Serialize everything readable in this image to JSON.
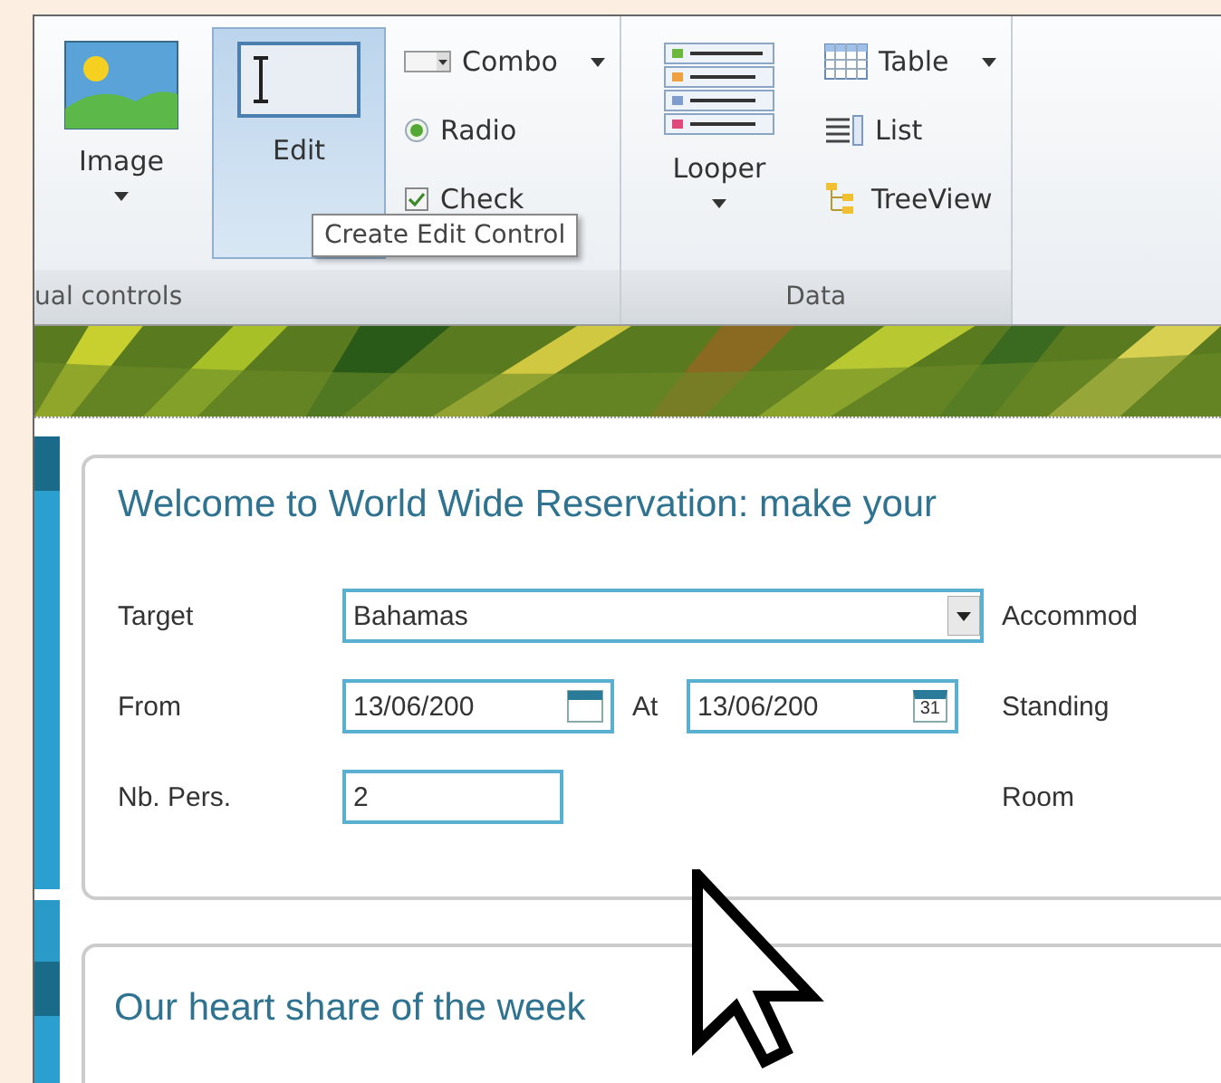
{
  "ribbon": {
    "groups": [
      {
        "label": "ual controls",
        "large_buttons": [
          {
            "label": "Image",
            "selected": false,
            "dropdown": true
          },
          {
            "label": "Edit",
            "kind": "edit",
            "selected": true,
            "dropdown": false
          }
        ],
        "small_buttons": [
          {
            "label": "Combo",
            "kind": "combo",
            "dropdown": true
          },
          {
            "label": "Radio",
            "kind": "radio",
            "dropdown": false,
            "checked": true
          },
          {
            "label": "Check",
            "kind": "check",
            "dropdown": false,
            "checked": true
          }
        ]
      },
      {
        "label": "Data",
        "large_buttons": [
          {
            "label": "Looper",
            "kind": "looper",
            "selected": false,
            "dropdown": true
          }
        ],
        "small_buttons": [
          {
            "label": "Table",
            "kind": "table",
            "dropdown": true
          },
          {
            "label": "List",
            "kind": "list",
            "dropdown": false
          },
          {
            "label": "TreeView",
            "kind": "tree",
            "dropdown": false
          }
        ]
      }
    ]
  },
  "tooltip": "Create Edit Control",
  "form": {
    "title": "Welcome to World Wide Reservation: make your",
    "rows": [
      {
        "label": "Target",
        "kind": "combo",
        "value": "Bahamas",
        "side_label": "Accommod"
      },
      {
        "label": "From",
        "kind": "dates",
        "value": "13/06/200",
        "to_label": "At",
        "to_value": "13/06/200",
        "to_day": "31",
        "side_label": "Standing"
      },
      {
        "label": "Nb. Pers.",
        "kind": "text",
        "value": "2",
        "side_label": "Room"
      }
    ]
  },
  "next_card": {
    "title": "Our heart share of the week"
  }
}
